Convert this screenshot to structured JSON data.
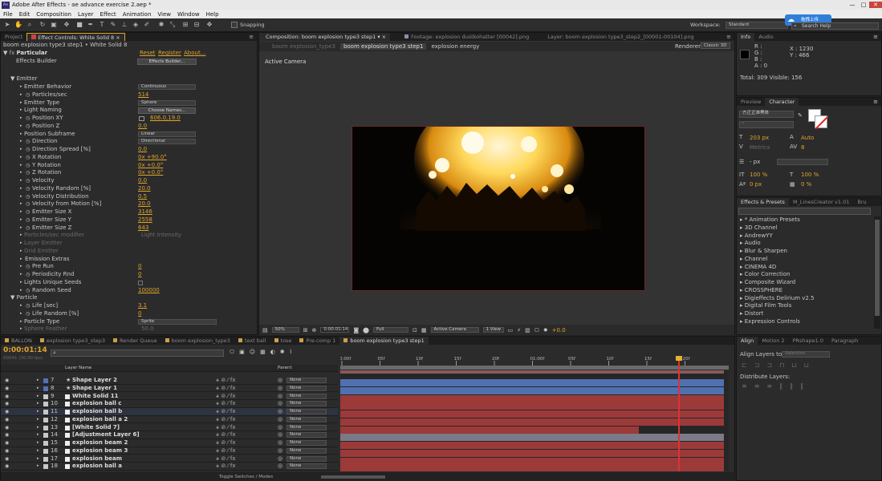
{
  "window": {
    "title": "Adobe After Effects - ae advance exercise 2.aep *"
  },
  "menu": [
    "File",
    "Edit",
    "Composition",
    "Layer",
    "Effect",
    "Animation",
    "View",
    "Window",
    "Help"
  ],
  "toolbar": {
    "snapping": "Snapping",
    "workspace_label": "Workspace:",
    "workspace_value": "Standard",
    "search_placeholder": "Search Help",
    "upload_label": "拖拽上传"
  },
  "left_tabs": [
    "Project",
    "Effect Controls: White Solid 8"
  ],
  "effect": {
    "breadcrumb": "boom explosion type3 step1 • White Solid 8",
    "name": "Particular",
    "reset": "Reset",
    "register": "Register",
    "about": "About...",
    "builder_label": "Effects Builder",
    "builder_button": "Effects Builder...",
    "emitter": "Emitter",
    "particle": "Particle"
  },
  "props": [
    {
      "label": "Emitter Behavior",
      "value": "Continuous",
      "kind": "dd"
    },
    {
      "label": "Particles/sec",
      "value": "514",
      "kind": "val",
      "stop": true
    },
    {
      "label": "Emitter Type",
      "value": "Sphere",
      "kind": "dd"
    },
    {
      "label": "Light Naming",
      "value": "Choose Names...",
      "kind": "btn"
    },
    {
      "label": "Position XY",
      "value": "606.0,19.0",
      "kind": "val",
      "stop": true,
      "target": true
    },
    {
      "label": "Position Z",
      "value": "0.0",
      "kind": "val",
      "stop": true
    },
    {
      "label": "Position Subframe",
      "value": "Linear",
      "kind": "dd"
    },
    {
      "label": "Direction",
      "value": "Directional",
      "kind": "dd",
      "stop": true
    },
    {
      "label": "Direction Spread [%]",
      "value": "0.0",
      "kind": "val",
      "stop": true
    },
    {
      "label": "X Rotation",
      "value": "0x +90.0°",
      "kind": "val",
      "stop": true
    },
    {
      "label": "Y Rotation",
      "value": "0x +0.0°",
      "kind": "val",
      "stop": true
    },
    {
      "label": "Z Rotation",
      "value": "0x +0.0°",
      "kind": "val",
      "stop": true
    },
    {
      "label": "Velocity",
      "value": "0.0",
      "kind": "val",
      "stop": true
    },
    {
      "label": "Velocity Random [%]",
      "value": "20.0",
      "kind": "val",
      "stop": true
    },
    {
      "label": "Velocity Distribution",
      "value": "0.5",
      "kind": "val",
      "stop": true
    },
    {
      "label": "Velocity from Motion [%]",
      "value": "20.0",
      "kind": "val",
      "stop": true
    },
    {
      "label": "Emitter Size X",
      "value": "3146",
      "kind": "val",
      "stop": true
    },
    {
      "label": "Emitter Size Y",
      "value": "2558",
      "kind": "val",
      "stop": true
    },
    {
      "label": "Emitter Size Z",
      "value": "643",
      "kind": "val",
      "stop": true
    },
    {
      "label": "Particles/sec modifier",
      "value": "Light Intensity",
      "kind": "dim"
    },
    {
      "label": "Layer Emitter",
      "value": "",
      "kind": "dim"
    },
    {
      "label": "Grid Emitter",
      "value": "",
      "kind": "dim"
    },
    {
      "label": "Emission Extras",
      "value": "",
      "kind": "head"
    },
    {
      "label": "Pre Run",
      "value": "0",
      "kind": "val",
      "stop": true
    },
    {
      "label": "Periodicity Rnd",
      "value": "0",
      "kind": "val",
      "stop": true
    },
    {
      "label": "Lights Unique Seeds",
      "value": "",
      "kind": "check"
    },
    {
      "label": "Random Seed",
      "value": "100000",
      "kind": "val",
      "stop": true
    }
  ],
  "props2": [
    {
      "label": "Life [sec]",
      "value": "3.1",
      "kind": "val",
      "stop": true
    },
    {
      "label": "Life Random [%]",
      "value": "0",
      "kind": "val",
      "stop": true
    },
    {
      "label": "Particle Type",
      "value": "Sprite",
      "kind": "dd"
    },
    {
      "label": "Sphere Feather",
      "value": "50.0",
      "kind": "dim"
    }
  ],
  "comp": {
    "tabs": [
      "Composition: boom explosion type3 step1",
      "Footage: explosion dustkohatter [00042].png",
      "Layer: boom explosion type3_step2_[00001-00104].png"
    ],
    "subtabs": [
      "boom explosion_type3",
      "boom explosion type3 step1",
      "explosion energy"
    ],
    "renderer_label": "Renderer:",
    "renderer_value": "Classic 3D",
    "camera": "Active Camera",
    "zoom": "50%",
    "time": "0:00:01:14",
    "quality": "Full",
    "view_camera": "Active Camera",
    "views": "1 View",
    "exposure": "+0.0"
  },
  "info": {
    "tabs": [
      "Info",
      "Audio"
    ],
    "rgb": [
      "R :",
      "G :",
      "B :",
      "A : 0"
    ],
    "x": "X : 1230",
    "y": "Y : 466",
    "stats": "Total: 309  Visible: 156"
  },
  "character": {
    "tabs": [
      "Preview",
      "Character"
    ],
    "font": "方正正准黑体",
    "style": "-",
    "size": "203 px",
    "leading": "Auto",
    "tracking": "8",
    "stroke": "- px",
    "vscale": "100 %",
    "hscale": "100 %",
    "baseline": "0 px",
    "tsume": "0 %",
    "metrics": "Metrics"
  },
  "effects_presets": {
    "tabs": [
      "Effects & Presets",
      "M_LinesCreator v1.01",
      "Bru"
    ],
    "items": [
      "* Animation Presets",
      "3D Channel",
      "AndrewYY",
      "Audio",
      "Blur & Sharpen",
      "Channel",
      "CINEMA 4D",
      "Color Correction",
      "Composite Wizard",
      "CROSSPHERE",
      "Digieffects Delirium v2.5",
      "Digital Film Tools",
      "Distort",
      "Expression Controls"
    ]
  },
  "align": {
    "tabs": [
      "Align",
      "Motion 2",
      "PRshape1.0",
      "Paragraph"
    ],
    "align_to": "Align Layers to:",
    "selection": "Selection",
    "distribute": "Distribute Layers:"
  },
  "timeline": {
    "tabs": [
      "BALLON",
      "explosion type3_step3",
      "Render Queue",
      "boom explosion_type3",
      "text ball",
      "tose",
      "Pre-comp 1",
      "boom explosion type3 step1"
    ],
    "timecode": "0:00:01:14",
    "fps": "00041 (30.00 fps)",
    "col_layer": "Layer Name",
    "col_parent": "Parent",
    "toggle": "Toggle Switches / Modes",
    "ruler": [
      "0:00f",
      "05f",
      "10f",
      "15f",
      "20f",
      "01:00f",
      "05f",
      "10f",
      "15f",
      "20f"
    ],
    "layers": [
      {
        "num": "7",
        "name": "Shape Layer 2",
        "color": "#5570b8",
        "bar": "#5070b0",
        "bold": true,
        "star": true
      },
      {
        "num": "8",
        "name": "Shape Layer 1",
        "color": "#5570b8",
        "bar": "#5070b0",
        "bold": true,
        "star": true
      },
      {
        "num": "9",
        "name": "White Solid 11",
        "color": "#c8c8c8",
        "bar": "#9c3a3a",
        "bold": true
      },
      {
        "num": "10",
        "name": "explosion ball c",
        "color": "#c8c8c8",
        "bar": "#9c3a3a",
        "bold": true
      },
      {
        "num": "11",
        "name": "explosion ball b",
        "color": "#c8c8c8",
        "bar": "#9c3a3a",
        "bold": true
      },
      {
        "num": "12",
        "name": "explosion ball a 2",
        "color": "#c8c8c8",
        "bar": "#9c3a3a",
        "bold": true
      },
      {
        "num": "13",
        "name": "[White Solid 7]",
        "color": "#c8c8c8",
        "bar": "#9c3a3a",
        "bold": true
      },
      {
        "num": "14",
        "name": "[Adjustment Layer 6]",
        "color": "#c8c8c8",
        "bar": "#7a7a8a",
        "bold": true
      },
      {
        "num": "15",
        "name": "explosion beam 2",
        "color": "#c8c8c8",
        "bar": "#9c3a3a",
        "bold": true
      },
      {
        "num": "16",
        "name": "explosion beam 3",
        "color": "#c8c8c8",
        "bar": "#9c3a3a",
        "bold": true
      },
      {
        "num": "17",
        "name": "explosion beam",
        "color": "#c8c8c8",
        "bar": "#9c3a3a",
        "bold": true
      },
      {
        "num": "18",
        "name": "explosion ball a",
        "color": "#c8c8c8",
        "bar": "#9c3a3a",
        "bold": true
      }
    ],
    "parent_value": "None"
  }
}
